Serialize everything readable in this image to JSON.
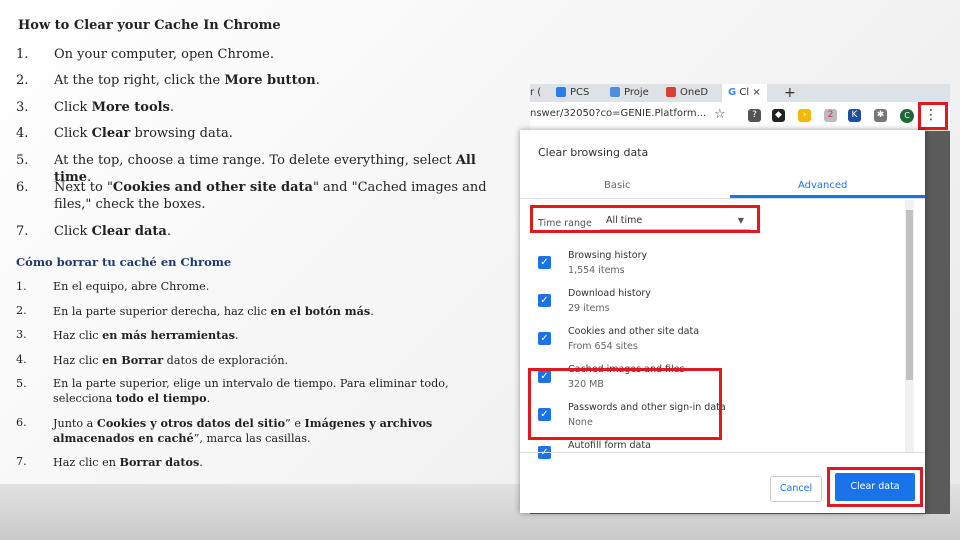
{
  "english": {
    "title": "How to Clear your Cache In Chrome",
    "steps": [
      {
        "num": "1.",
        "pre": "On your computer, open Chrome.",
        "bold": "",
        "post": ""
      },
      {
        "num": "2.",
        "pre": "At the top right, click the ",
        "bold": "More button",
        "post": "."
      },
      {
        "num": "3.",
        "pre": "Click ",
        "bold": "More tools",
        "post": "."
      },
      {
        "num": "4.",
        "pre": "Click ",
        "bold": "Clear",
        "post": " browsing data."
      },
      {
        "num": "5.",
        "pre": "At the top, choose a time range. To delete everything, select ",
        "bold": "All time",
        "post": "."
      },
      {
        "num": "6.",
        "pre": "Next to \"",
        "bold": "Cookies and other site data",
        "post": "\" and \"Cached images and files,\" check the boxes."
      },
      {
        "num": "7.",
        "pre": "Click ",
        "bold": "Clear data",
        "post": "."
      }
    ]
  },
  "spanish": {
    "title": "Cómo borrar tu caché en Chrome",
    "steps": [
      {
        "num": "1.",
        "html": "En el equipo, abre Chrome."
      },
      {
        "num": "2.",
        "html": "En la parte superior derecha, haz clic <b>en el botón más</b>."
      },
      {
        "num": "3.",
        "html": "Haz clic <b>en más herramientas</b>."
      },
      {
        "num": "4.",
        "html": "Haz clic <b>en Borrar</b> datos de exploración."
      },
      {
        "num": "5.",
        "html": "En la parte superior, elige un intervalo de tiempo. Para eliminar todo, selecciona <b>todo el tiempo</b>."
      },
      {
        "num": "6.",
        "html": "Junto a <b>Cookies y otros datos del sitio</b>” e <b>Imágenes y archivos almacenados en caché</b>”, marca las casillas."
      },
      {
        "num": "7.",
        "html": "Haz clic en <b>Borrar datos</b>."
      }
    ]
  },
  "browser": {
    "tabs": [
      "r (",
      "PCS",
      "Proje",
      "OneD",
      "G",
      "Cl",
      "×",
      "+"
    ],
    "url": "nswer/32050?co=GENIE.Platform...",
    "avatar": "C",
    "ext_badge": "2"
  },
  "dialog": {
    "title": "Clear browsing data",
    "tab_basic": "Basic",
    "tab_advanced": "Advanced",
    "time_range_label": "Time range",
    "time_range_value": "All time",
    "items": [
      {
        "title": "Browsing history",
        "sub": "1,554 items"
      },
      {
        "title": "Download history",
        "sub": "29 items"
      },
      {
        "title": "Cookies and other site data",
        "sub": "From 654 sites"
      },
      {
        "title": "Cached images and files",
        "sub": "320 MB"
      },
      {
        "title": "Passwords and other sign-in data",
        "sub": "None"
      },
      {
        "title": "Autofill form data",
        "sub": ""
      }
    ],
    "cancel": "Cancel",
    "clear": "Clear data"
  },
  "colors": {
    "highlight": "#e0191f",
    "accent": "#1a73e8"
  }
}
